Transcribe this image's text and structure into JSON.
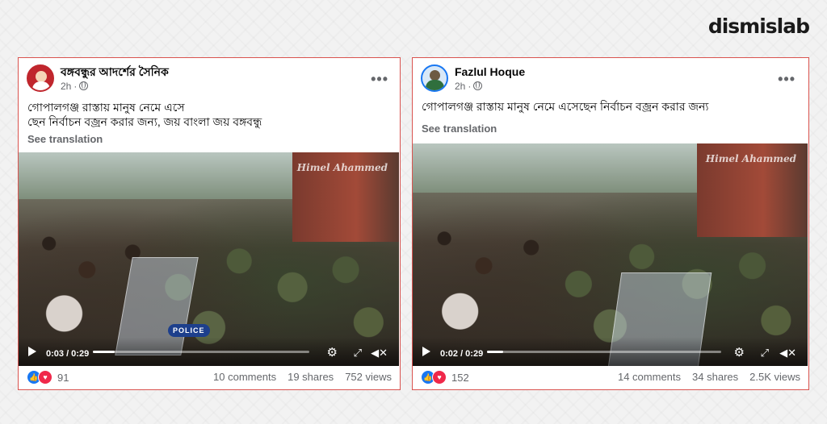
{
  "brand": {
    "logo_text": "dismislab"
  },
  "posts": [
    {
      "author": "বঙ্গবন্ধুর আদর্শের সৈনিক",
      "time": "2h",
      "text_lines": [
        "গোপালগঞ্জ রাস্তায় মানুষ  নেমে এসে",
        "ছেন  নির্বাচন বজ্রন করার জন্য, জয় বাংলা জয় বঙ্গবন্ধু"
      ],
      "see_translation": "See translation",
      "video": {
        "watermark": "Himel Ahammed",
        "overlay_label": "POLICE",
        "time_display": "0:03 / 0:29",
        "progress": 0.1
      },
      "reaction_count": "91",
      "comments": "10 comments",
      "shares": "19 shares",
      "views": "752 views"
    },
    {
      "author": "Fazlul Hoque",
      "time": "2h",
      "text_lines": [
        "গোপালগঞ্জ রাস্তায় মানুষ  নেমে এসেছেন  নির্বাচন বজ্রন করার জন্য"
      ],
      "see_translation": "See translation",
      "video": {
        "watermark": "Himel Ahammed",
        "time_display": "0:02 / 0:29",
        "progress": 0.07
      },
      "reaction_count": "152",
      "comments": "14 comments",
      "shares": "34 shares",
      "views": "2.5K views"
    }
  ],
  "icons": {
    "more": "more-options-icon",
    "globe": "globe-icon",
    "play": "play-icon",
    "settings": "gear-icon",
    "fullscreen": "fullscreen-icon",
    "volume": "volume-icon",
    "like": "like-reaction-icon",
    "love": "love-reaction-icon"
  },
  "colors": {
    "card_border": "#d9534f",
    "like": "#1877f2",
    "love": "#f0284a",
    "meta": "#65676b"
  }
}
